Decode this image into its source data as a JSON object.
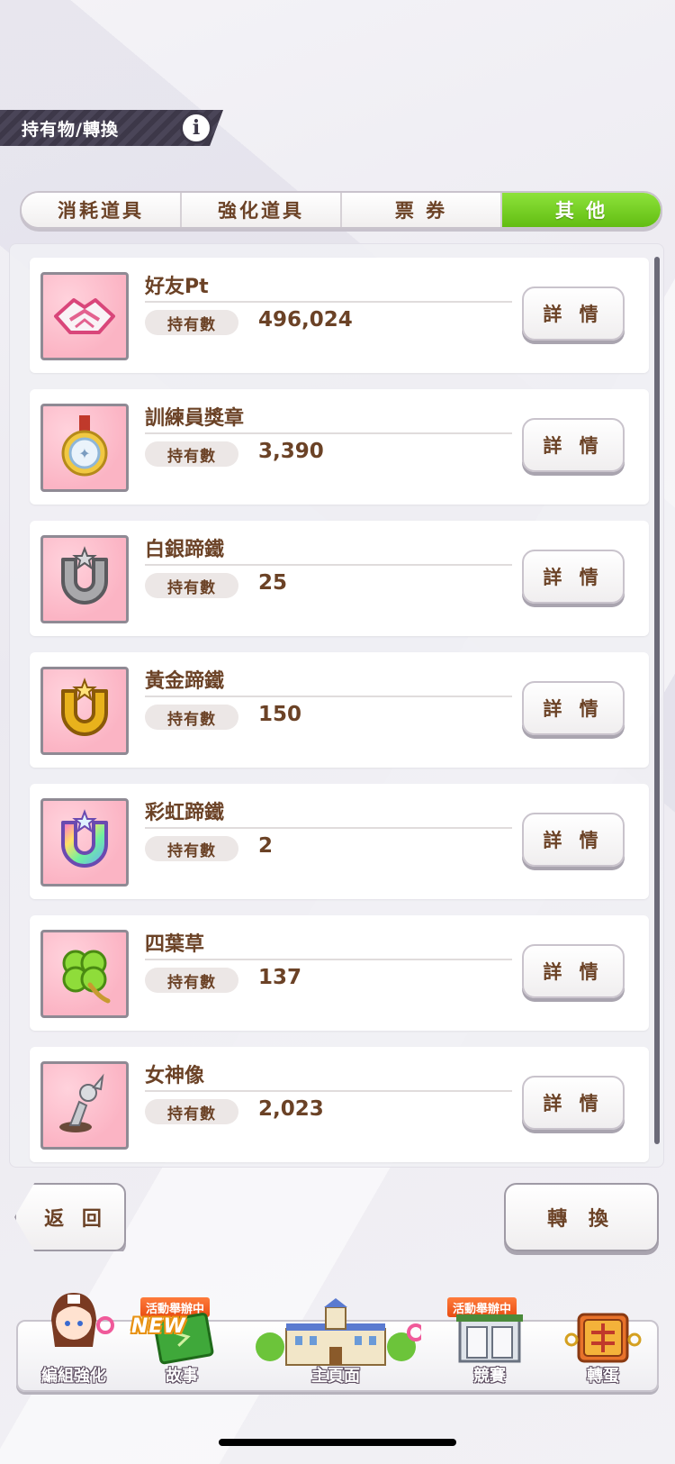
{
  "header": {
    "title": "持有物/轉換",
    "info_icon": "info-icon"
  },
  "tabs": [
    {
      "label": "消耗道具",
      "active": false
    },
    {
      "label": "強化道具",
      "active": false
    },
    {
      "label": "票 券",
      "active": false
    },
    {
      "label": "其 他",
      "active": true
    }
  ],
  "items": [
    {
      "name": "好友Pt",
      "own_label": "持有數",
      "value": "496,024",
      "icon": "handshake-icon",
      "detail_label": "詳 情"
    },
    {
      "name": "訓練員獎章",
      "own_label": "持有數",
      "value": "3,390",
      "icon": "medal-icon",
      "detail_label": "詳 情"
    },
    {
      "name": "白銀蹄鐵",
      "own_label": "持有數",
      "value": "25",
      "icon": "silver-horseshoe-icon",
      "detail_label": "詳 情"
    },
    {
      "name": "黃金蹄鐵",
      "own_label": "持有數",
      "value": "150",
      "icon": "gold-horseshoe-icon",
      "detail_label": "詳 情"
    },
    {
      "name": "彩虹蹄鐵",
      "own_label": "持有數",
      "value": "2",
      "icon": "rainbow-horseshoe-icon",
      "detail_label": "詳 情"
    },
    {
      "name": "四葉草",
      "own_label": "持有數",
      "value": "137",
      "icon": "clover-icon",
      "detail_label": "詳 情"
    },
    {
      "name": "女神像",
      "own_label": "持有數",
      "value": "2,023",
      "icon": "goddess-statue-icon",
      "detail_label": "詳 情"
    }
  ],
  "actions": {
    "back_label": "返 回",
    "convert_label": "轉 換"
  },
  "bottom_nav": {
    "items": [
      {
        "label": "編組強化",
        "icon": "character-icon"
      },
      {
        "label": "故事",
        "icon": "story-book-icon",
        "badge": "活動舉辦中",
        "new": "NEW"
      },
      {
        "label": "主頁面",
        "icon": "school-building-icon"
      },
      {
        "label": "競賽",
        "icon": "race-gate-icon",
        "badge": "活動舉辦中"
      },
      {
        "label": "轉蛋",
        "icon": "gacha-gate-icon"
      }
    ]
  },
  "colors": {
    "accent_green": "#6cc81c",
    "text_brown": "#6b4226",
    "event_orange": "#f05a1c"
  }
}
